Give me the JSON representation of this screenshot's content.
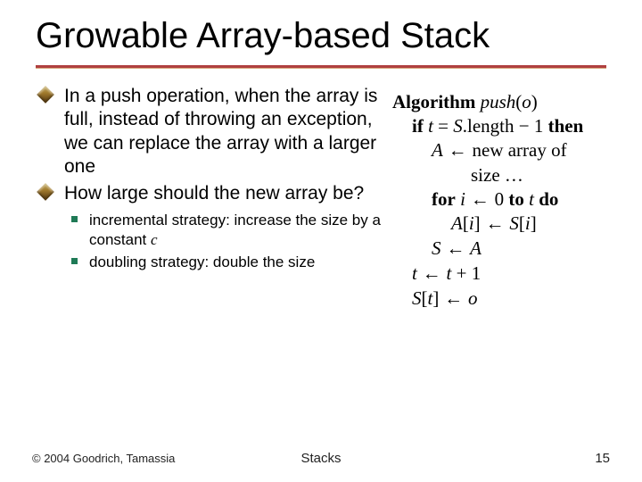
{
  "title": "Growable Array-based Stack",
  "bullets": {
    "b1": "In a push operation, when the array is full, instead of throwing an exception, we can replace the array with a larger one",
    "b2": "How large should the new array be?",
    "sub1_prefix": "incremental strategy: increase the size by a constant ",
    "sub1_var": "c",
    "sub2": "doubling strategy: double the size"
  },
  "algo": {
    "kw_algorithm": "Algorithm",
    "fn_name": "push",
    "fn_arg": "o",
    "kw_if": "if",
    "var_t": "t",
    "eq": " = ",
    "var_S": "S",
    "dot_length": ".length",
    "minus_one": " − 1 ",
    "kw_then": "then",
    "var_A": "A",
    "arrow": " ← ",
    "new_array_of": "new array of",
    "size_word": "size …",
    "kw_for": "for",
    "var_i": "i",
    "zero": "0",
    "kw_to": " to ",
    "kw_do": "do",
    "br_open": "[",
    "br_close": "]",
    "plus_one": " + 1",
    "var_o": "o"
  },
  "footer": {
    "copyright": "© 2004 Goodrich, Tamassia",
    "center": "Stacks",
    "page": "15"
  }
}
